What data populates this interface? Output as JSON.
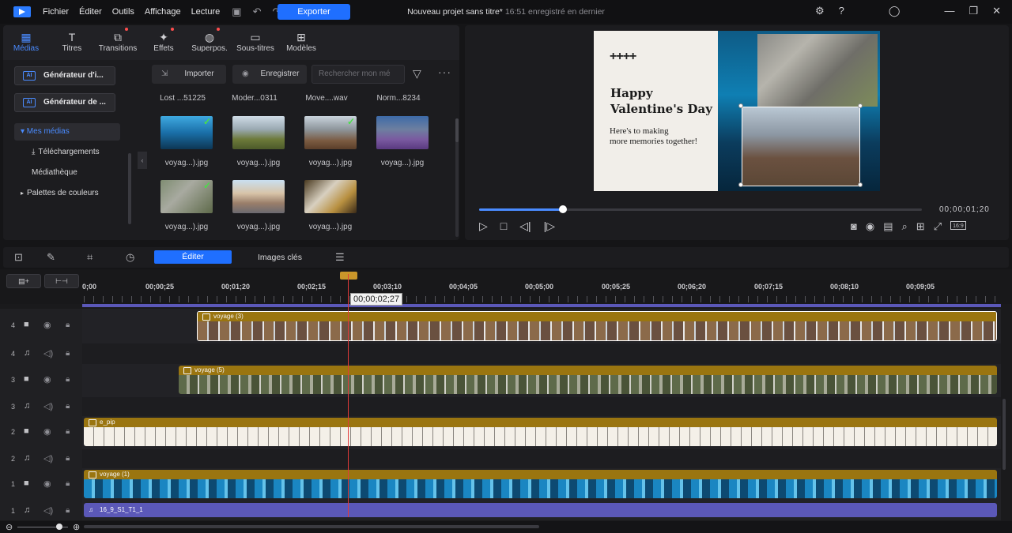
{
  "app": {
    "menu": [
      "Fichier",
      "Éditer",
      "Outils",
      "Affichage",
      "Lecture"
    ],
    "export_label": "Exporter",
    "project_title": "Nouveau projet sans titre*",
    "saved_status": "16:51 enregistré en dernier",
    "accent_color": "#1f6fff"
  },
  "library": {
    "tabs": [
      {
        "label": "Médias",
        "icon": "media-icon"
      },
      {
        "label": "Titres",
        "icon": "title-icon"
      },
      {
        "label": "Transitions",
        "icon": "transition-icon"
      },
      {
        "label": "Effets",
        "icon": "effects-icon"
      },
      {
        "label": "Superpos.",
        "icon": "overlay-icon"
      },
      {
        "label": "Sous-titres",
        "icon": "subtitles-icon"
      },
      {
        "label": "Modèles",
        "icon": "templates-icon"
      }
    ],
    "generators": [
      "Générateur d'i...",
      "Générateur de ..."
    ],
    "sidebar_items": [
      "▾ Mes médias",
      "Téléchargements",
      "Médiathèque",
      "Palettes de couleurs"
    ],
    "import_label": "Importer",
    "record_label": "Enregistrer",
    "search_placeholder": "Rechercher mon mé",
    "top_names": [
      "Lost ...51225",
      "Moder...0311",
      "Move....wav",
      "Norm...8234"
    ],
    "thumbs": [
      {
        "label": "voyag...).jpg",
        "checked": true
      },
      {
        "label": "voyag...).jpg",
        "checked": false
      },
      {
        "label": "voyag...).jpg",
        "checked": true
      },
      {
        "label": "voyag...).jpg",
        "checked": false
      },
      {
        "label": "voyag...).jpg",
        "checked": true
      },
      {
        "label": "voyag...).jpg",
        "checked": false
      },
      {
        "label": "voyag...).jpg",
        "checked": false
      }
    ]
  },
  "preview": {
    "card_line1": "Happy",
    "card_line2": "Valentine's Day",
    "card_sub1": "Here's to making",
    "card_sub2": "more memories together!",
    "hash_symbol": "++++",
    "timecode": "00;00;01;20",
    "ratio_label": "16:9",
    "progress": 0.19
  },
  "edit_toolbar": {
    "edit_tab": "Éditer",
    "keyframes_tab": "Images clés"
  },
  "timeline": {
    "ruler": [
      "0;00",
      "00;00;25",
      "00;01;20",
      "00;02;15",
      "00;03;10",
      "00;04;05",
      "00;05;00",
      "00;05;25",
      "00;06;20",
      "00;07;15",
      "00;08;10",
      "00;09;05"
    ],
    "playhead_time": "00;00;02;27",
    "tracks": [
      {
        "num": "4",
        "type": "video",
        "clip": "voyage (3)"
      },
      {
        "num": "4",
        "type": "audio",
        "clip": ""
      },
      {
        "num": "3",
        "type": "video",
        "clip": "voyage (5)"
      },
      {
        "num": "3",
        "type": "audio",
        "clip": ""
      },
      {
        "num": "2",
        "type": "video",
        "clip": "e_pip"
      },
      {
        "num": "2",
        "type": "audio",
        "clip": ""
      },
      {
        "num": "1",
        "type": "video",
        "clip": "voyage (1)"
      },
      {
        "num": "1",
        "type": "audio",
        "clip": "16_9_S1_T1_1"
      }
    ]
  }
}
